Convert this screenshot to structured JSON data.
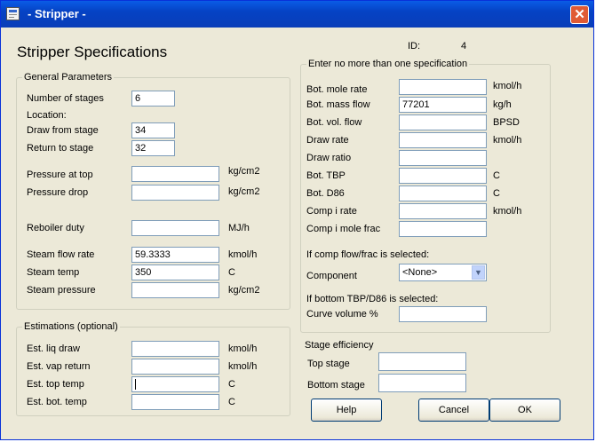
{
  "window": {
    "title": "- Stripper -",
    "close_glyph": "✕"
  },
  "page_title": "Stripper Specifications",
  "id_label": "ID:",
  "id_value": "4",
  "general": {
    "legend": "General Parameters",
    "number_of_stages_label": "Number of stages",
    "number_of_stages": "6",
    "location_label": "Location:",
    "draw_from_stage_label": "Draw from stage",
    "draw_from_stage": "34",
    "return_to_stage_label": "Return to stage",
    "return_to_stage": "32",
    "pressure_top_label": "Pressure at top",
    "pressure_top": "",
    "pressure_top_unit": "kg/cm2",
    "pressure_drop_label": "Pressure drop",
    "pressure_drop": "",
    "pressure_drop_unit": "kg/cm2",
    "reboiler_duty_label": "Reboiler duty",
    "reboiler_duty": "",
    "reboiler_duty_unit": "MJ/h",
    "steam_flow_label": "Steam flow rate",
    "steam_flow": "59.3333",
    "steam_flow_unit": "kmol/h",
    "steam_temp_label": "Steam temp",
    "steam_temp": "350",
    "steam_temp_unit": "C",
    "steam_pressure_label": "Steam pressure",
    "steam_pressure": "",
    "steam_pressure_unit": "kg/cm2"
  },
  "estimations": {
    "legend": "Estimations (optional)",
    "liq_draw_label": "Est. liq draw",
    "liq_draw": "",
    "liq_draw_unit": "kmol/h",
    "vap_return_label": "Est. vap return",
    "vap_return": "",
    "vap_return_unit": "kmol/h",
    "top_temp_label": "Est. top temp",
    "top_temp": "",
    "top_temp_unit": "C",
    "bot_temp_label": "Est. bot. temp",
    "bot_temp": "",
    "bot_temp_unit": "C"
  },
  "spec": {
    "legend": "Enter no more than one specification",
    "bot_mole_rate_label": "Bot. mole rate",
    "bot_mole_rate": "",
    "bot_mole_rate_unit": "kmol/h",
    "bot_mass_flow_label": "Bot. mass flow",
    "bot_mass_flow": "77201",
    "bot_mass_flow_unit": "kg/h",
    "bot_vol_flow_label": "Bot. vol. flow",
    "bot_vol_flow": "",
    "bot_vol_flow_unit": "BPSD",
    "draw_rate_label": "Draw rate",
    "draw_rate": "",
    "draw_rate_unit": "kmol/h",
    "draw_ratio_label": "Draw ratio",
    "draw_ratio": "",
    "bot_tbp_label": "Bot. TBP",
    "bot_tbp": "",
    "bot_tbp_unit": "C",
    "bot_d86_label": "Bot. D86",
    "bot_d86": "",
    "bot_d86_unit": "C",
    "comp_rate_label": "Comp i rate",
    "comp_rate": "",
    "comp_rate_unit": "kmol/h",
    "comp_mole_frac_label": "Comp i mole frac",
    "comp_mole_frac": "",
    "comp_note": "If comp flow/frac is selected:",
    "component_label": "Component",
    "component_value": "<None>",
    "tbp_note": "If bottom TBP/D86 is selected:",
    "curve_volume_label": "Curve volume %",
    "curve_volume": ""
  },
  "efficiency": {
    "legend": "Stage efficiency",
    "top_stage_label": "Top stage",
    "top_stage": "",
    "bottom_stage_label": "Bottom stage",
    "bottom_stage": ""
  },
  "buttons": {
    "help": "Help",
    "cancel": "Cancel",
    "ok": "OK"
  }
}
